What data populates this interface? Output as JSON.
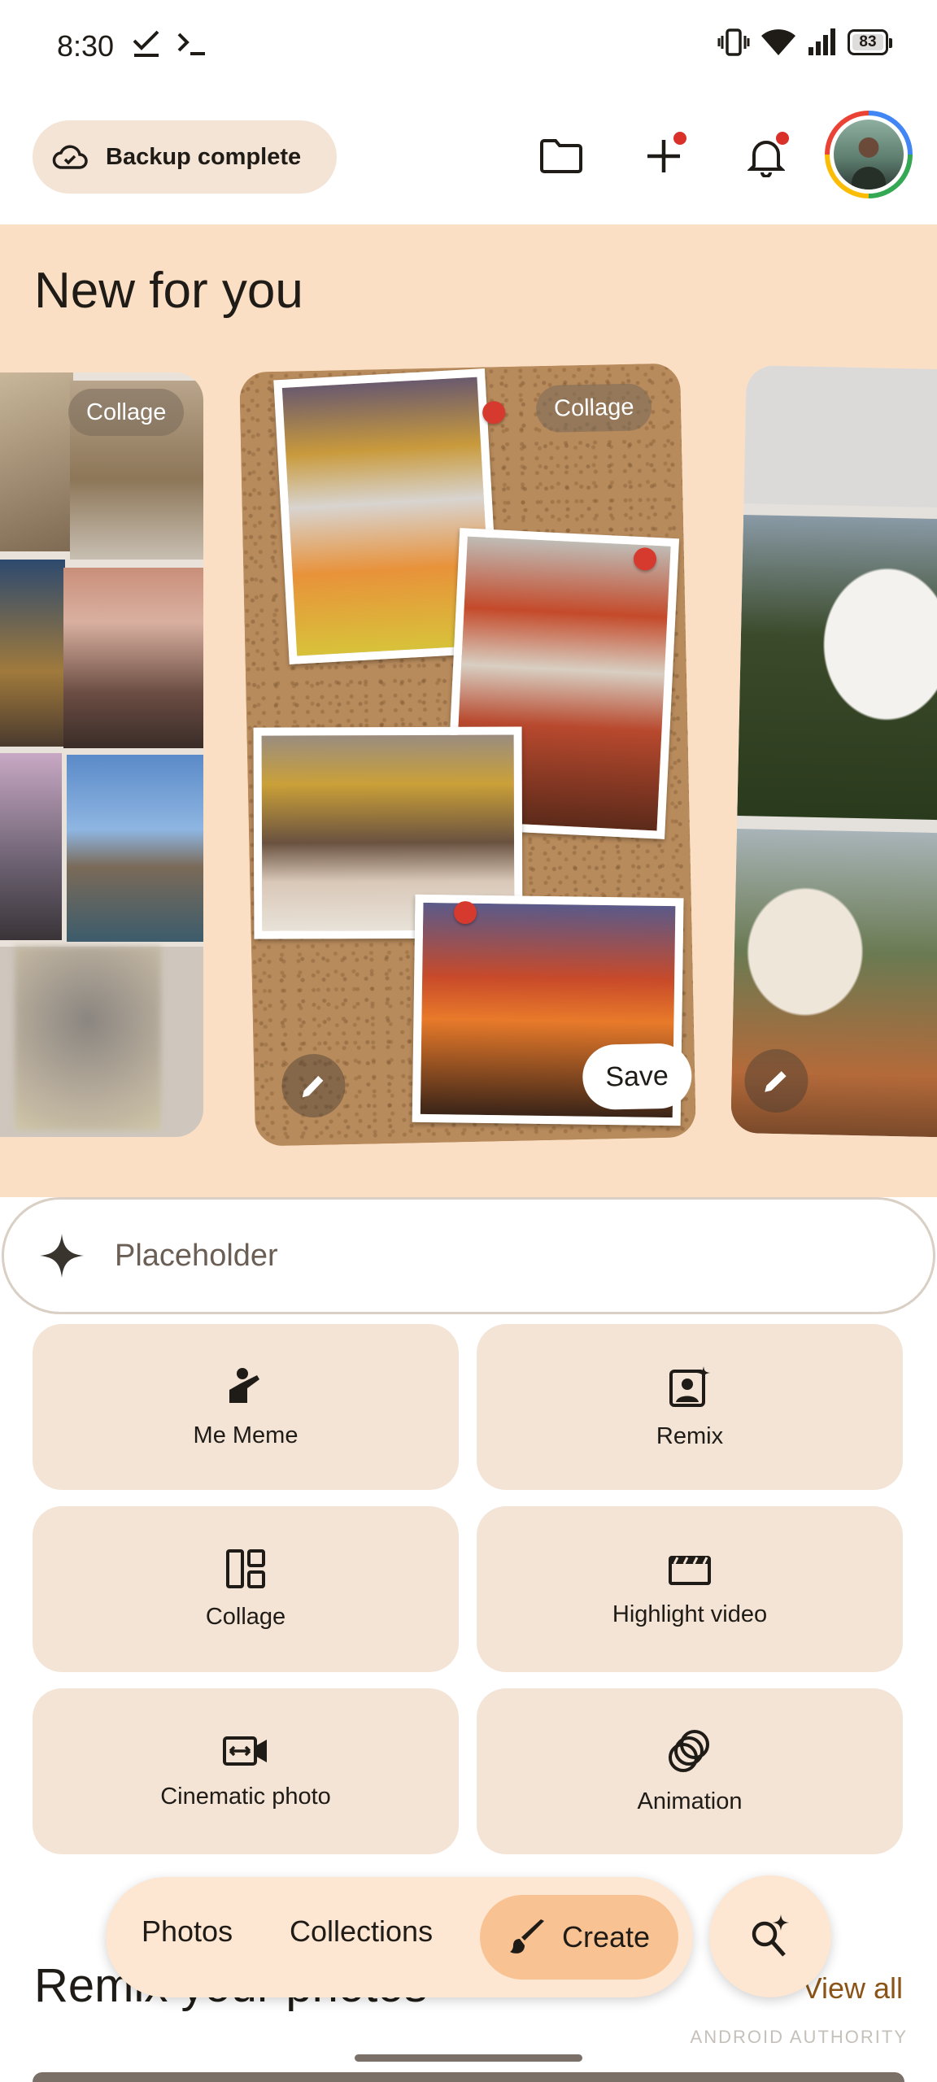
{
  "status_bar": {
    "time": "8:30",
    "battery": "83"
  },
  "header": {
    "backup_label": "Backup complete",
    "icons": [
      "cloud-check-icon",
      "folder-icon",
      "add-icon",
      "bell-icon",
      "avatar"
    ]
  },
  "new_for_you": {
    "title": "New for you",
    "cards": [
      {
        "chip": "Collage"
      },
      {
        "chip": "Collage",
        "save_label": "Save"
      },
      {}
    ]
  },
  "prompt": {
    "placeholder": "Placeholder"
  },
  "tools": [
    {
      "label": "Me Meme",
      "icon": "me-meme-icon"
    },
    {
      "label": "Remix",
      "icon": "remix-icon"
    },
    {
      "label": "Collage",
      "icon": "collage-icon"
    },
    {
      "label": "Highlight video",
      "icon": "highlight-video-icon"
    },
    {
      "label": "Cinematic photo",
      "icon": "cinematic-photo-icon"
    },
    {
      "label": "Animation",
      "icon": "animation-icon"
    }
  ],
  "remix_section": {
    "title": "Remix your photos",
    "view_all": "View all"
  },
  "watermark": "ANDROID AUTHORITY",
  "bottom_nav": {
    "photos": "Photos",
    "collections": "Collections",
    "create": "Create"
  },
  "colors": {
    "accent": "#f9c293",
    "section_bg": "#fbdfc4",
    "tile_bg": "#f4e4d6",
    "notification_dot": "#d9302a"
  }
}
